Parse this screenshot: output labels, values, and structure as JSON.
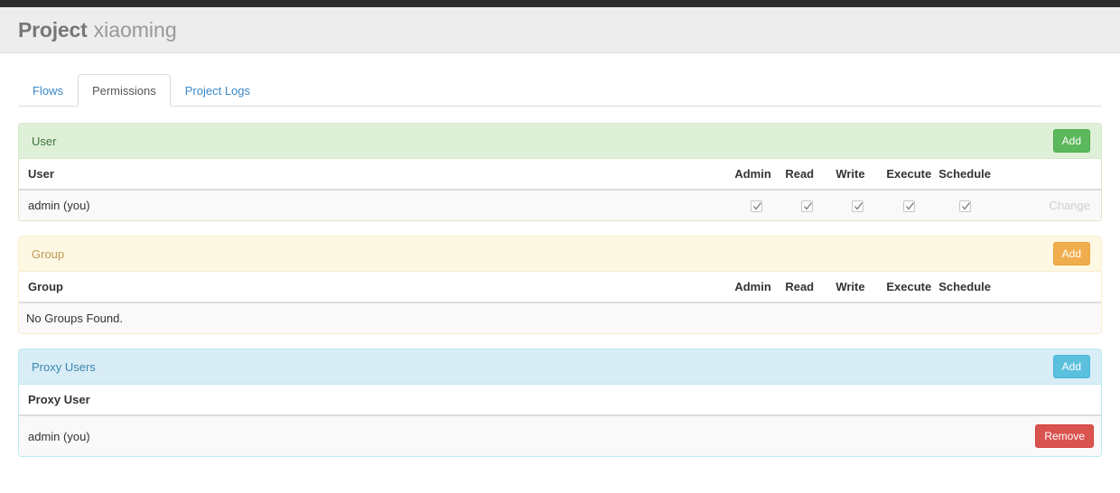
{
  "header": {
    "title_strong": "Project",
    "title_light": "xiaoming"
  },
  "tabs": [
    {
      "label": "Flows",
      "active": false
    },
    {
      "label": "Permissions",
      "active": true
    },
    {
      "label": "Project Logs",
      "active": false
    }
  ],
  "panels": {
    "user": {
      "heading": "User",
      "add_label": "Add",
      "columns": [
        "User",
        "Admin",
        "Read",
        "Write",
        "Execute",
        "Schedule"
      ],
      "rows": [
        {
          "name": "admin (you)",
          "admin": true,
          "read": true,
          "write": true,
          "execute": true,
          "schedule": true,
          "action_label": "Change"
        }
      ]
    },
    "group": {
      "heading": "Group",
      "add_label": "Add",
      "columns": [
        "Group",
        "Admin",
        "Read",
        "Write",
        "Execute",
        "Schedule"
      ],
      "empty_message": "No Groups Found."
    },
    "proxy": {
      "heading": "Proxy Users",
      "add_label": "Add",
      "columns": [
        "Proxy User"
      ],
      "rows": [
        {
          "name": "admin (you)",
          "action_label": "Remove"
        }
      ]
    }
  },
  "colors": {
    "navbar": "#2d2d2d",
    "header_band": "#ededed",
    "tab_link": "#3a87c8",
    "success": "#5cb85c",
    "warning": "#f0ad4e",
    "info": "#5bc0de",
    "danger": "#d9534f"
  }
}
